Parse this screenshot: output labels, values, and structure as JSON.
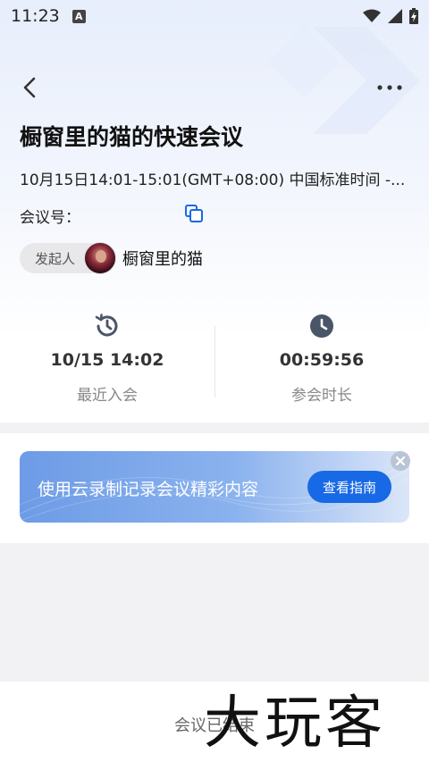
{
  "status_bar": {
    "time": "11:23",
    "notification_badge": "A",
    "icons": [
      "wifi-icon",
      "signal-icon",
      "battery-icon"
    ]
  },
  "header": {
    "back_icon": "chevron-left-icon",
    "more_icon": "more-horizontal-icon"
  },
  "meeting": {
    "title": "橱窗里的猫的快速会议",
    "time_range": "10月15日14:01-15:01(GMT+08:00) 中国标准时间 -...",
    "meeting_id_label": "会议号：",
    "copy_icon": "copy-icon",
    "host_label": "发起人",
    "host_name": "橱窗里的猫"
  },
  "stats": {
    "last_join": {
      "value": "10/15 14:02",
      "label": "最近入会",
      "icon": "history-clock-icon"
    },
    "duration": {
      "value": "00:59:56",
      "label": "参会时长",
      "icon": "clock-icon"
    }
  },
  "promo": {
    "text": "使用云录制记录会议精彩内容",
    "button_label": "查看指南",
    "close_icon": "close-icon"
  },
  "footer": {
    "ended_text": "会议已结束"
  },
  "watermark": {
    "text": "大玩客"
  },
  "colors": {
    "accent": "#1769e6",
    "header_gradient_top": "#e7eefc",
    "background": "#f2f2f4"
  }
}
